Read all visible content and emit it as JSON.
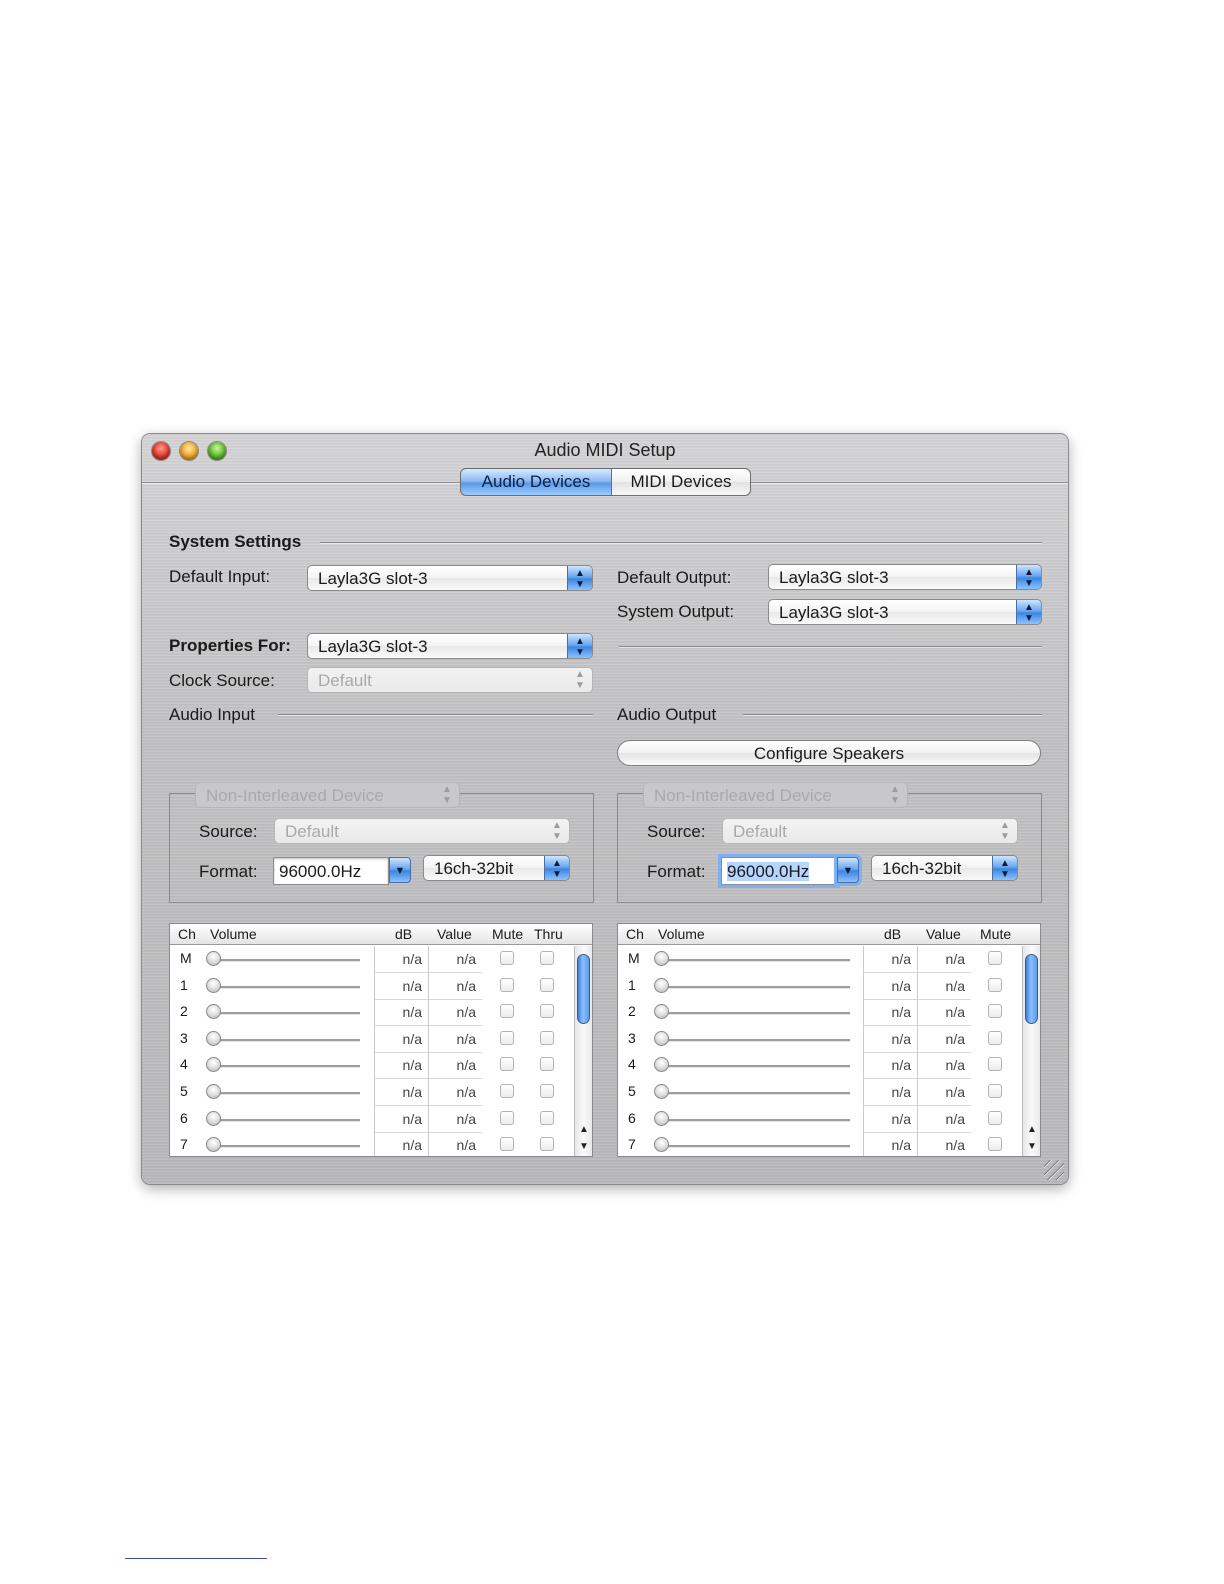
{
  "window": {
    "title": "Audio MIDI Setup",
    "tabs": [
      {
        "label": "Audio Devices",
        "selected": true
      },
      {
        "label": "MIDI Devices",
        "selected": false
      }
    ]
  },
  "system_settings": {
    "heading": "System Settings",
    "default_input_label": "Default Input:",
    "default_input_value": "Layla3G slot-3",
    "default_output_label": "Default Output:",
    "default_output_value": "Layla3G slot-3",
    "system_output_label": "System Output:",
    "system_output_value": "Layla3G slot-3"
  },
  "properties": {
    "label": "Properties For:",
    "value": "Layla3G slot-3",
    "clock_source_label": "Clock Source:",
    "clock_source_value": "Default"
  },
  "audio_input": {
    "heading": "Audio Input",
    "device_mode": "Non-Interleaved Device",
    "source_label": "Source:",
    "source_value": "Default",
    "format_label": "Format:",
    "format_rate": "96000.0Hz",
    "format_channels": "16ch-32bit",
    "table": {
      "headers": {
        "ch": "Ch",
        "volume": "Volume",
        "db": "dB",
        "value": "Value",
        "mute": "Mute",
        "thru": "Thru"
      },
      "rows": [
        {
          "ch": "M",
          "db": "n/a",
          "value": "n/a"
        },
        {
          "ch": "1",
          "db": "n/a",
          "value": "n/a"
        },
        {
          "ch": "2",
          "db": "n/a",
          "value": "n/a"
        },
        {
          "ch": "3",
          "db": "n/a",
          "value": "n/a"
        },
        {
          "ch": "4",
          "db": "n/a",
          "value": "n/a"
        },
        {
          "ch": "5",
          "db": "n/a",
          "value": "n/a"
        },
        {
          "ch": "6",
          "db": "n/a",
          "value": "n/a"
        },
        {
          "ch": "7",
          "db": "n/a",
          "value": "n/a"
        }
      ]
    }
  },
  "audio_output": {
    "heading": "Audio Output",
    "configure_button": "Configure Speakers",
    "device_mode": "Non-Interleaved Device",
    "source_label": "Source:",
    "source_value": "Default",
    "format_label": "Format:",
    "format_rate": "96000.0Hz",
    "format_channels": "16ch-32bit",
    "table": {
      "headers": {
        "ch": "Ch",
        "volume": "Volume",
        "db": "dB",
        "value": "Value",
        "mute": "Mute"
      },
      "rows": [
        {
          "ch": "M",
          "db": "n/a",
          "value": "n/a"
        },
        {
          "ch": "1",
          "db": "n/a",
          "value": "n/a"
        },
        {
          "ch": "2",
          "db": "n/a",
          "value": "n/a"
        },
        {
          "ch": "3",
          "db": "n/a",
          "value": "n/a"
        },
        {
          "ch": "4",
          "db": "n/a",
          "value": "n/a"
        },
        {
          "ch": "5",
          "db": "n/a",
          "value": "n/a"
        },
        {
          "ch": "6",
          "db": "n/a",
          "value": "n/a"
        },
        {
          "ch": "7",
          "db": "n/a",
          "value": "n/a"
        }
      ]
    }
  },
  "icons": {
    "popup_arrows": "up-down-arrows-icon",
    "combo_arrow": "down-arrow-icon",
    "resize_grip": "resize-grip-icon"
  },
  "colors": {
    "accent": "#5a9ae6",
    "window_close": "#e0382a",
    "window_minimize": "#f0a52a",
    "window_zoom": "#5ab92c"
  }
}
